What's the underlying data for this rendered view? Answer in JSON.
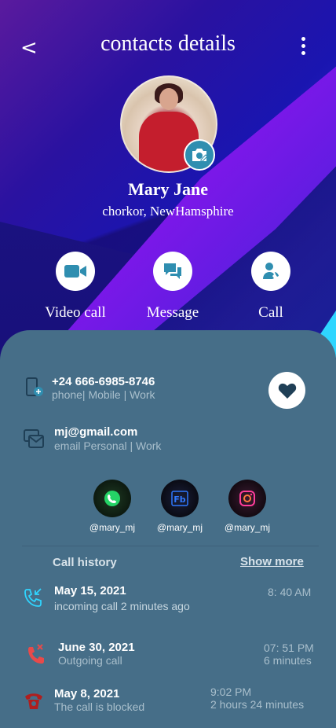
{
  "header": {
    "back_label": "<",
    "title": "contacts details"
  },
  "contact": {
    "name": "Mary Jane",
    "location": "chorkor, NewHamsphire"
  },
  "actions": [
    {
      "label": "Video call",
      "icon": "video-icon"
    },
    {
      "label": "Message",
      "icon": "message-icon"
    },
    {
      "label": "Call",
      "icon": "person-call-icon"
    }
  ],
  "phone": {
    "number": "+24 666-6985-8746",
    "detail": "phone| Mobile | Work"
  },
  "email": {
    "address": "mj@gmail.com",
    "detail": "email Personal | Work"
  },
  "socials": [
    {
      "handle": "@mary_mj",
      "icon": "whatsapp-icon"
    },
    {
      "handle": "@mary_mj",
      "icon": "facebook-icon"
    },
    {
      "handle": "@mary_mj",
      "icon": "instagram-icon"
    }
  ],
  "call_history": {
    "title": "Call history",
    "show_more": "Show more",
    "items": [
      {
        "date": "May 15, 2021",
        "desc": "incoming call 2 minutes ago",
        "time": "8: 40 AM",
        "duration": "",
        "icon": "incoming-call-icon"
      },
      {
        "date": "June 30, 2021",
        "desc": "Outgoing call",
        "time": "07: 51 PM",
        "duration": "6 minutes",
        "icon": "missed-call-icon"
      },
      {
        "date": "May 8, 2021",
        "desc": "The call is blocked",
        "time": "9:02 PM",
        "duration": "2 hours 24 minutes",
        "icon": "blocked-call-icon"
      }
    ]
  },
  "colors": {
    "card": "#466e88",
    "accent": "#2f8eb0",
    "gradient_start": "#5a1a9e",
    "gradient_end": "#1e3ee6"
  }
}
